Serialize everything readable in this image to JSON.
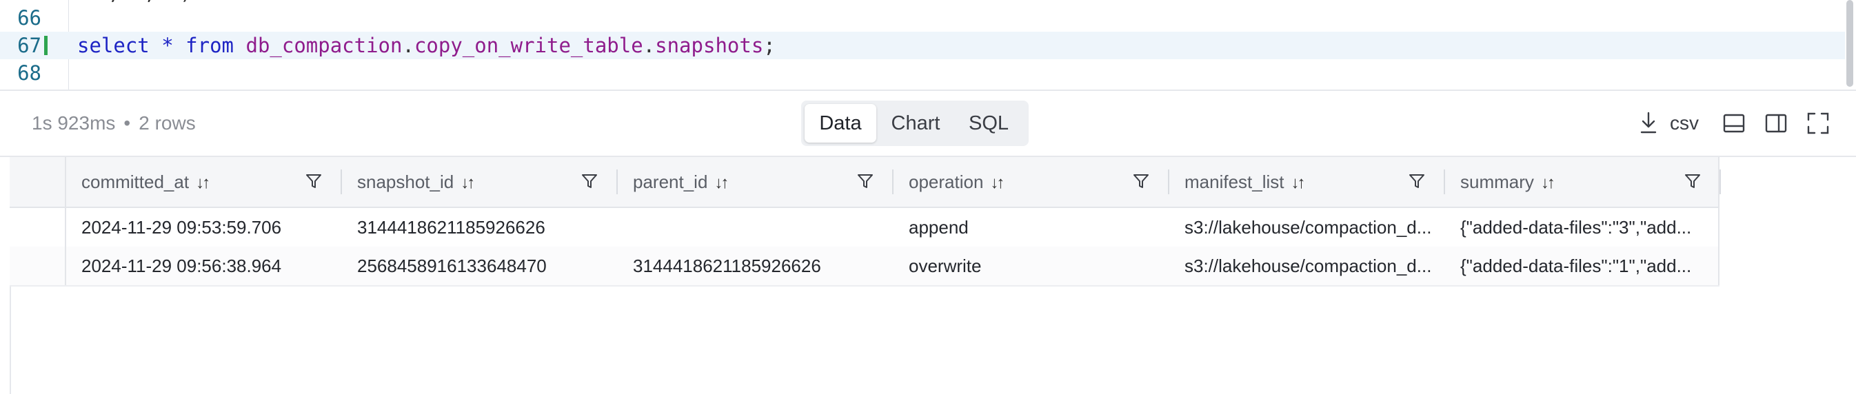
{
  "editor": {
    "lines": [
      {
        "num": "66"
      },
      {
        "num": "67",
        "kw1": "select",
        "star": "*",
        "kw2": "from",
        "db": "db_compaction",
        "dot1": ".",
        "tbl": "copy_on_write_table",
        "dot2": ".",
        "meta": "snapshots",
        "semi": ";"
      },
      {
        "num": "68"
      }
    ]
  },
  "results": {
    "elapsed": "1s 923ms",
    "separator": "•",
    "rows_count": "2 rows",
    "tabs": [
      {
        "label": "Data",
        "active": true
      },
      {
        "label": "Chart",
        "active": false
      },
      {
        "label": "SQL",
        "active": false
      }
    ],
    "export_label": "csv"
  },
  "table": {
    "columns": [
      "committed_at",
      "snapshot_id",
      "parent_id",
      "operation",
      "manifest_list",
      "summary"
    ],
    "sort_glyph": "↓↑",
    "rows": [
      [
        "2024-11-29 09:53:59.706",
        "3144418621185926626",
        "",
        "append",
        "s3://lakehouse/compaction_d...",
        "{\"added-data-files\":\"3\",\"add..."
      ],
      [
        "2024-11-29 09:56:38.964",
        "2568458916133648470",
        "3144418621185926626",
        "overwrite",
        "s3://lakehouse/compaction_d...",
        "{\"added-data-files\":\"1\",\"add..."
      ]
    ]
  },
  "colors": {
    "accent_green": "#2ea44f",
    "keyword": "#1d24c4",
    "identifier": "#8f1c8c"
  }
}
